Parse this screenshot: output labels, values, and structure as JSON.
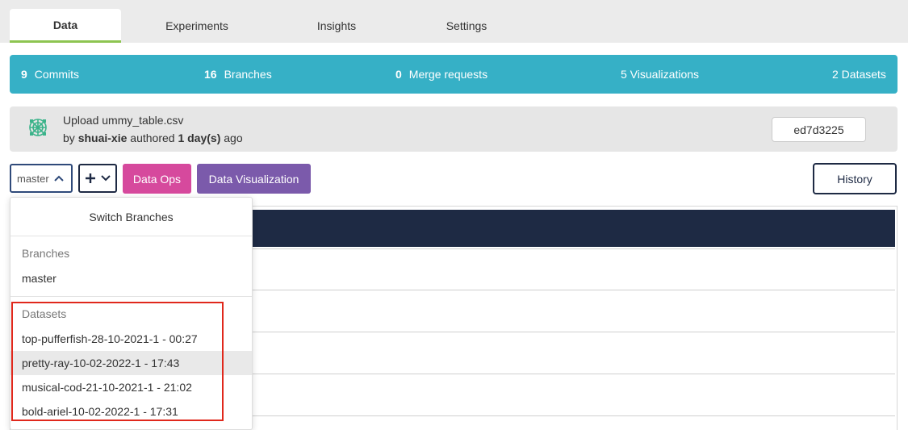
{
  "tabs": [
    {
      "label": "Data",
      "active": true
    },
    {
      "label": "Experiments",
      "active": false
    },
    {
      "label": "Insights",
      "active": false
    },
    {
      "label": "Settings",
      "active": false
    }
  ],
  "stats": {
    "commits": {
      "count": "9",
      "label": "Commits"
    },
    "branches": {
      "count": "16",
      "label": "Branches"
    },
    "merge_requests": {
      "count": "0",
      "label": "Merge requests"
    },
    "visualizations": {
      "label": "5 Visualizations"
    },
    "datasets": {
      "label": "2 Datasets"
    }
  },
  "commit": {
    "title": "Upload ummy_table.csv",
    "by_prefix": "by",
    "author": "shuai-xie",
    "authored_word": "authored",
    "time": "1 day(s)",
    "ago": "ago",
    "sha": "ed7d3225"
  },
  "toolbar": {
    "branch": "master",
    "data_ops": "Data Ops",
    "data_visualization": "Data Visualization",
    "history": "History"
  },
  "dropdown": {
    "title": "Switch Branches",
    "branches_heading": "Branches",
    "branches": [
      "master"
    ],
    "datasets_heading": "Datasets",
    "datasets": [
      "top-pufferfish-28-10-2021-1 - 00:27",
      "pretty-ray-10-02-2022-1 - 17:43",
      "musical-cod-21-10-2021-1 - 21:02",
      "bold-ariel-10-02-2022-1 - 17:31"
    ]
  },
  "colors": {
    "stats_bar": "#36b0c6",
    "active_tab_underline": "#8dc451",
    "data_ops": "#d6499d",
    "data_visualization": "#7b5aab",
    "table_header": "#1e2a44",
    "highlight": "#e0281c"
  }
}
